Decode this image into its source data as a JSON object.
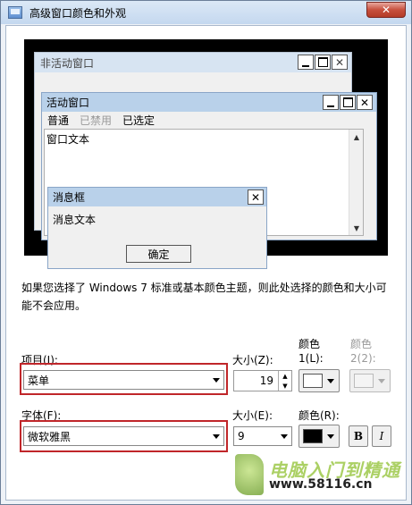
{
  "window": {
    "title": "高级窗口颜色和外观",
    "close_label": "✕"
  },
  "preview": {
    "inactive_title": "非活动窗口",
    "active_title": "活动窗口",
    "menu": {
      "normal": "普通",
      "disabled": "已禁用",
      "selected": "已选定"
    },
    "window_text": "窗口文本",
    "msgbox_title": "消息框",
    "msgbox_text": "消息文本",
    "ok_label": "确定"
  },
  "description": "如果您选择了 Windows 7 标准或基本颜色主题，则此处选择的颜色和大小可能不会应用。",
  "item": {
    "label": "项目(I):",
    "value": "菜单",
    "size_label": "大小(Z):",
    "size_value": "19",
    "color1_label_line1": "颜色",
    "color1_label_line2": "1(L):",
    "color2_label_line1": "颜色",
    "color2_label_line2": "2(2):",
    "color1_value": "#ffffff"
  },
  "font": {
    "label": "字体(F):",
    "value": "微软雅黑",
    "size_label": "大小(E):",
    "size_value": "9",
    "color_label": "颜色(R):",
    "color_value": "#000000",
    "bold_label": "B",
    "italic_label": "I"
  },
  "watermark": {
    "cn": "电脑入门到精通",
    "url": "www.58116.cn"
  },
  "colors": {
    "highlight": "#c0262a",
    "title_active": "#b9d1ea",
    "title_inactive": "#d7e4f2"
  }
}
